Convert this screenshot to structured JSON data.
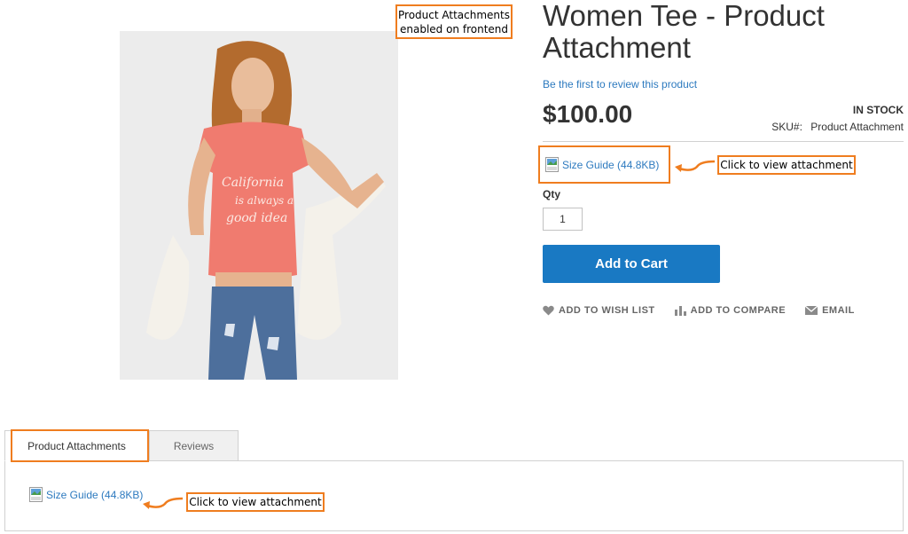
{
  "product": {
    "title": "Women Tee - Product Attachment",
    "review_link": "Be the first to review this product",
    "price": "$100.00",
    "stock": "IN STOCK",
    "sku_label": "SKU#:",
    "sku_value": "Product Attachment",
    "qty_label": "Qty",
    "qty_value": "1",
    "add_to_cart": "Add to Cart"
  },
  "attachment": {
    "label": "Size Guide (44.8KB)",
    "icon": "jpg-file-icon"
  },
  "actions": [
    {
      "label": "ADD TO WISH LIST",
      "icon": "heart-icon"
    },
    {
      "label": "ADD TO COMPARE",
      "icon": "bar-chart-icon"
    },
    {
      "label": "EMAIL",
      "icon": "envelope-icon"
    }
  ],
  "callouts": {
    "top_line1": "Product Attachments",
    "top_line2": "enabled on frontend",
    "click_view": "Click to view attachment"
  },
  "tabs": [
    {
      "label": "Product Attachments",
      "active": true
    },
    {
      "label": "Reviews",
      "active": false
    }
  ],
  "colors": {
    "accent_orange": "#ef7d1f",
    "link_blue": "#2d7abf",
    "button_blue": "#1979c3",
    "shirt_coral": "#f07b6f"
  }
}
